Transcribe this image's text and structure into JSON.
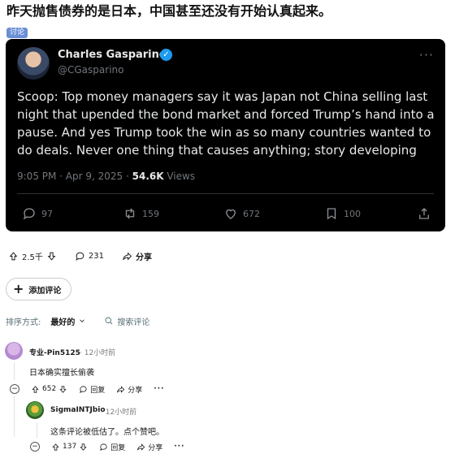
{
  "post": {
    "title": "昨天抛售债券的是日本，中国甚至还没有开始认真起来。",
    "flair": "讨论"
  },
  "tweet": {
    "author_name": "Charles Gasparino",
    "author_handle": "@CGasparino",
    "text": "Scoop: Top money managers say it was Japan not China selling last night that upended the bond market and forced Trump’s hand into a pause. And yes Trump took the win as so many countries wanted to do deals. Never one thing that causes anything; story developing",
    "timestamp": "9:05 PM · Apr 9, 2025 · ",
    "views_count": "54.6K",
    "views_label": " Views",
    "replies": "97",
    "retweets": "159",
    "likes": "672",
    "bookmarks": "100",
    "more_label": "···",
    "verified_color": "#1d9bf0"
  },
  "post_actions": {
    "votes": "2.5千",
    "comments": "231",
    "share_label": "分享"
  },
  "add_comment_label": "添加评论",
  "sort": {
    "label": "排序方式:",
    "value": "最好的",
    "search_placeholder": "搜索评论"
  },
  "comments": [
    {
      "author": "专业-Pin5125",
      "time": "· 12小时前",
      "body": "日本确实擅长偷袭",
      "votes": "652",
      "reply_label": "回复",
      "share_label": "分享",
      "more": "···",
      "collapse": "−"
    },
    {
      "author": "SigmaINTJbio",
      "time": "· 12小时前",
      "body": "这条评论被低估了。点个赞吧。",
      "votes": "137",
      "reply_label": "回复",
      "share_label": "分享",
      "more": "···",
      "collapse": "−"
    }
  ]
}
